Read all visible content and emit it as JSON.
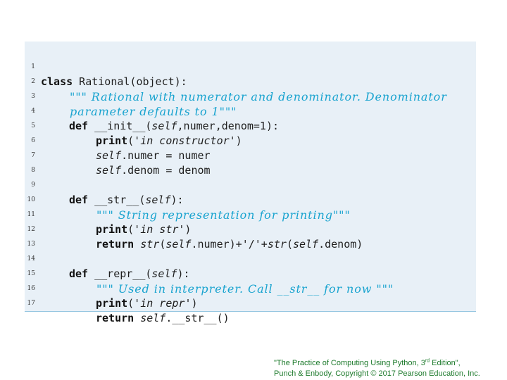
{
  "code": {
    "line_numbers": [
      "1",
      "2",
      "3",
      "4",
      "5",
      "6",
      "7",
      "8",
      "9",
      "10",
      "11",
      "12",
      "13",
      "14",
      "15",
      "16",
      "17"
    ],
    "line1": {
      "kw": "class",
      "rest": " Rational(object):"
    },
    "line2": {
      "doc": "\"\"\" Rational with numerator and denominator. Denominator"
    },
    "line3": {
      "doc": "parameter defaults to 1\"\"\""
    },
    "line4": {
      "kw": "def",
      "a": " __init__(",
      "self": "self",
      "b": ",numer,denom=1):"
    },
    "line5": {
      "kw": "print",
      "a": "('",
      "it": "in constructor",
      "b": "')"
    },
    "line6": {
      "self": "self",
      "a": ".numer = numer"
    },
    "line7": {
      "self": "self",
      "a": ".denom = denom"
    },
    "line9": {
      "kw": "def",
      "a": " __str__(",
      "self": "self",
      "b": "):"
    },
    "line10": {
      "doc": "\"\"\" String representation for printing\"\"\""
    },
    "line11": {
      "kw": "print",
      "a": "('",
      "it": "in str",
      "b": "')"
    },
    "line12": {
      "kw": "return",
      "str1": "str",
      "a": "(",
      "self1": "self",
      "b": ".numer)+'/'+",
      "str2": "str",
      "c": "(",
      "self2": "self",
      "d": ".denom)"
    },
    "line14": {
      "kw": "def",
      "a": " __repr__(",
      "self": "self",
      "b": "):"
    },
    "line15": {
      "doc": "\"\"\" Used in interpreter. Call __str__ for now \"\"\""
    },
    "line16": {
      "kw": "print",
      "a": "('",
      "it": "in repr",
      "b": "')"
    },
    "line17": {
      "kw": "return",
      "self": "self",
      "a": ".__str__()"
    }
  },
  "credit": {
    "line1_prefix": "\"The Practice of Computing Using Python, 3",
    "line1_sup": "rd",
    "line1_suffix": " Edition\",",
    "line2": "Punch & Enbody, Copyright © 2017 Pearson Education, Inc."
  },
  "colors": {
    "panel_bg": "#e8f0f7",
    "docstring": "#18a3cf",
    "credit": "#1d7a2c"
  }
}
